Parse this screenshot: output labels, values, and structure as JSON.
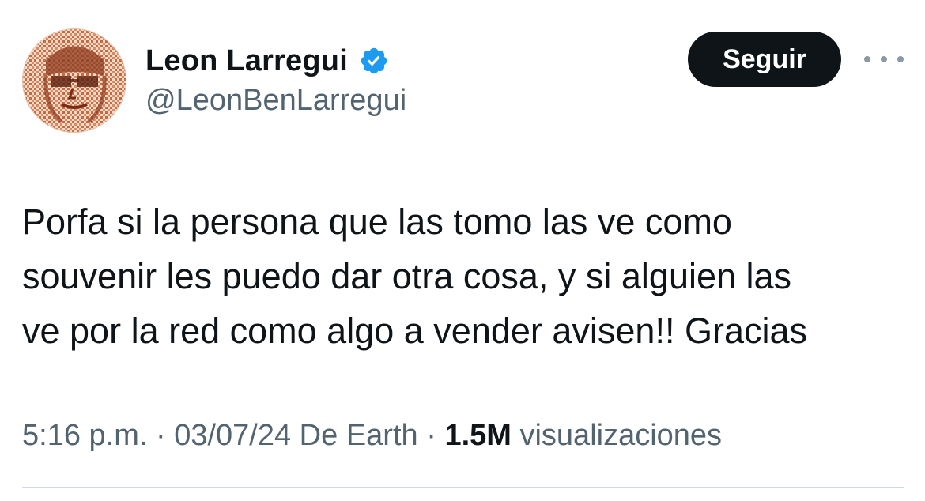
{
  "user": {
    "display_name": "Leon Larregui",
    "handle": "@LeonBenLarregui",
    "verified_badge_icon": "verified-badge-icon",
    "verified_color": "#1d9bf0"
  },
  "actions": {
    "follow_label": "Seguir",
    "more_icon": "more-horizontal-icon"
  },
  "tweet": {
    "lines": [
      "Porfa si la persona que las tomo las ve como",
      "souvenir les puedo dar otra cosa, y si alguien las",
      "ve por la red como algo a vender avisen!! Gracias"
    ]
  },
  "meta": {
    "time": "5:16 p.m.",
    "sep1": " · ",
    "date": "03/07/24",
    "location": " De Earth",
    "sep2": " · ",
    "views_count": "1.5M",
    "views_label": " visualizaciones"
  },
  "colors": {
    "text_primary": "#0f1419",
    "text_secondary": "#536471",
    "button_bg": "#0f1419",
    "divider": "#cfd9de"
  }
}
